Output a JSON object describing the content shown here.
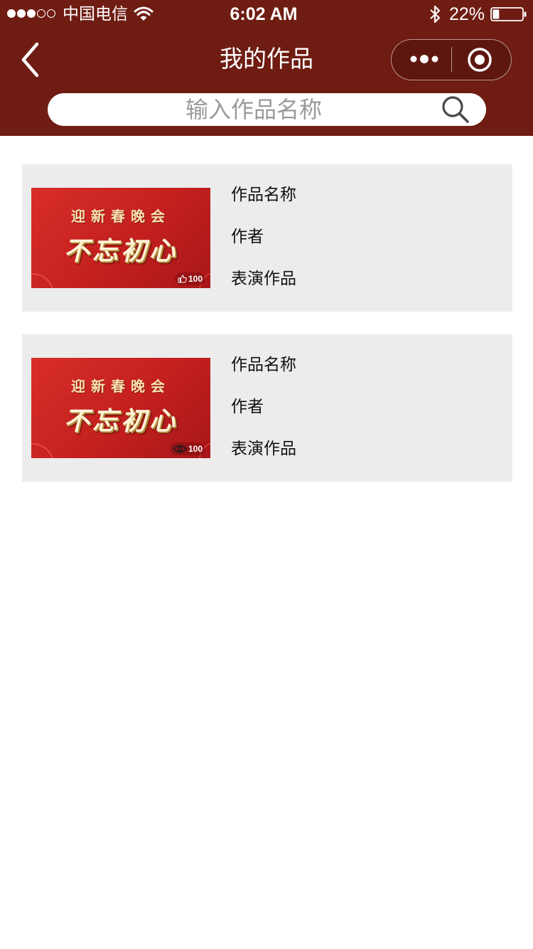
{
  "status_bar": {
    "carrier": "中国电信",
    "time": "6:02 AM",
    "battery": "22%",
    "signal_bars_filled": 3,
    "signal_bars_total": 5,
    "battery_level": 0.22
  },
  "nav": {
    "title": "我的作品",
    "back_icon": "chevron-left-icon",
    "more_icon": "more-dots-icon",
    "close_icon": "target-circle-icon"
  },
  "search": {
    "placeholder": "输入作品名称",
    "value": "",
    "icon": "search-icon"
  },
  "works": [
    {
      "name": "作品名称",
      "author": "作者",
      "type": "表演作品",
      "thumbnail": {
        "subtitle": "迎新春晚会",
        "title": "不忘初心"
      },
      "stat_icon": "thumb-up-icon",
      "stat_count": "100"
    },
    {
      "name": "作品名称",
      "author": "作者",
      "type": "表演作品",
      "thumbnail": {
        "subtitle": "迎新春晚会",
        "title": "不忘初心"
      },
      "stat_icon": "eye-icon",
      "stat_count": "100"
    }
  ],
  "colors": {
    "header_bg": "#6f1c12",
    "card_bg": "#ececec",
    "thumbnail_red": "#c3201e",
    "placeholder": "#9a9a9a"
  }
}
